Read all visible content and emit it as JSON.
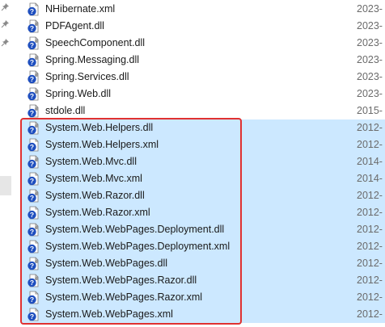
{
  "files": [
    {
      "name": "NHibernate.xml",
      "date": "2023-",
      "type": "xml",
      "selected": false
    },
    {
      "name": "PDFAgent.dll",
      "date": "2023-",
      "type": "dll",
      "selected": false
    },
    {
      "name": "SpeechComponent.dll",
      "date": "2023-",
      "type": "dll",
      "selected": false
    },
    {
      "name": "Spring.Messaging.dll",
      "date": "2023-",
      "type": "dll",
      "selected": false
    },
    {
      "name": "Spring.Services.dll",
      "date": "2023-",
      "type": "dll",
      "selected": false
    },
    {
      "name": "Spring.Web.dll",
      "date": "2023-",
      "type": "dll",
      "selected": false
    },
    {
      "name": "stdole.dll",
      "date": "2015-",
      "type": "dll",
      "selected": false
    },
    {
      "name": "System.Web.Helpers.dll",
      "date": "2012-",
      "type": "dll",
      "selected": true
    },
    {
      "name": "System.Web.Helpers.xml",
      "date": "2012-",
      "type": "xml",
      "selected": true
    },
    {
      "name": "System.Web.Mvc.dll",
      "date": "2014-",
      "type": "dll",
      "selected": true
    },
    {
      "name": "System.Web.Mvc.xml",
      "date": "2014-",
      "type": "xml",
      "selected": true
    },
    {
      "name": "System.Web.Razor.dll",
      "date": "2012-",
      "type": "dll",
      "selected": true
    },
    {
      "name": "System.Web.Razor.xml",
      "date": "2012-",
      "type": "xml",
      "selected": true
    },
    {
      "name": "System.Web.WebPages.Deployment.dll",
      "date": "2012-",
      "type": "dll",
      "selected": true
    },
    {
      "name": "System.Web.WebPages.Deployment.xml",
      "date": "2012-",
      "type": "xml",
      "selected": true
    },
    {
      "name": "System.Web.WebPages.dll",
      "date": "2012-",
      "type": "dll",
      "selected": true
    },
    {
      "name": "System.Web.WebPages.Razor.dll",
      "date": "2012-",
      "type": "dll",
      "selected": true
    },
    {
      "name": "System.Web.WebPages.Razor.xml",
      "date": "2012-",
      "type": "xml",
      "selected": true
    },
    {
      "name": "System.Web.WebPages.xml",
      "date": "2012-",
      "type": "xml",
      "selected": true
    }
  ],
  "colors": {
    "selection": "#cce8ff",
    "highlight_border": "#e03131",
    "icon_blue": "#1f4fbf",
    "date_text": "#6b6b6b"
  },
  "icons": {
    "dll": "dll-file-icon",
    "xml": "xml-file-icon",
    "pin": "pin-icon"
  }
}
